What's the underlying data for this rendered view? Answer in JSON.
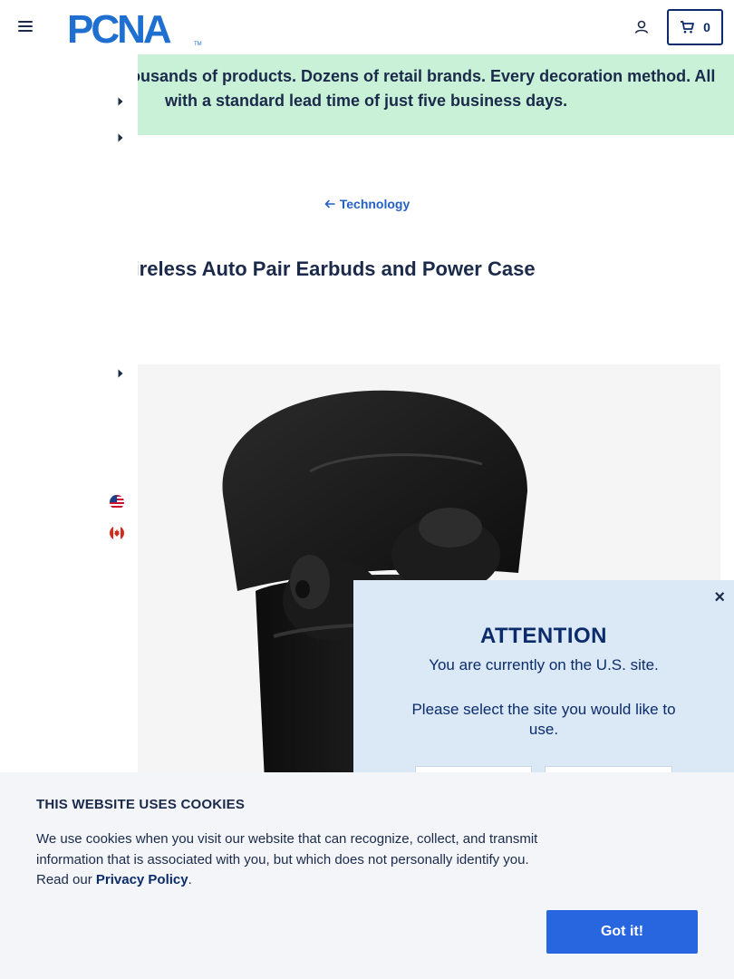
{
  "header": {
    "logo_text": "PCNA",
    "logo_tm": "TM",
    "cart_count": "0"
  },
  "banner": {
    "line1": "Thousands of products. Dozens of retail brands. Every decoration method. All",
    "line2": "with a standard lead time of just five business days."
  },
  "breadcrumb": {
    "label": "Technology"
  },
  "product": {
    "title": "Wireless Auto Pair Earbuds and Power Case"
  },
  "attention": {
    "close_label": "×",
    "title": "ATTENTION",
    "line1": "You are currently on the U.S. site.",
    "line2": "Please select the site you would like to use."
  },
  "cookie": {
    "title": "THIS WEBSITE USES COOKIES",
    "text_before": "We use cookies when you visit our website that can recognize, collect, and transmit information that is associated with you, but which does not personally identify you. Read our ",
    "link": "Privacy Policy",
    "text_after": ".",
    "button": "Got it!"
  },
  "colors": {
    "brand_navy": "#0b2b6b",
    "logo_blue": "#1f6fd1",
    "banner_green": "#c9f1d8",
    "link_blue": "#2461c6",
    "button_blue": "#2766de",
    "modal_bg": "#dbe8f6"
  },
  "icons": {
    "menu": "hamburger-icon",
    "account": "user-icon",
    "cart": "cart-icon",
    "back": "arrow-left-icon",
    "caret": "caret-right-icon",
    "flag_us": "us-flag-icon",
    "flag_ca": "canada-flag-icon",
    "close": "close-icon"
  }
}
